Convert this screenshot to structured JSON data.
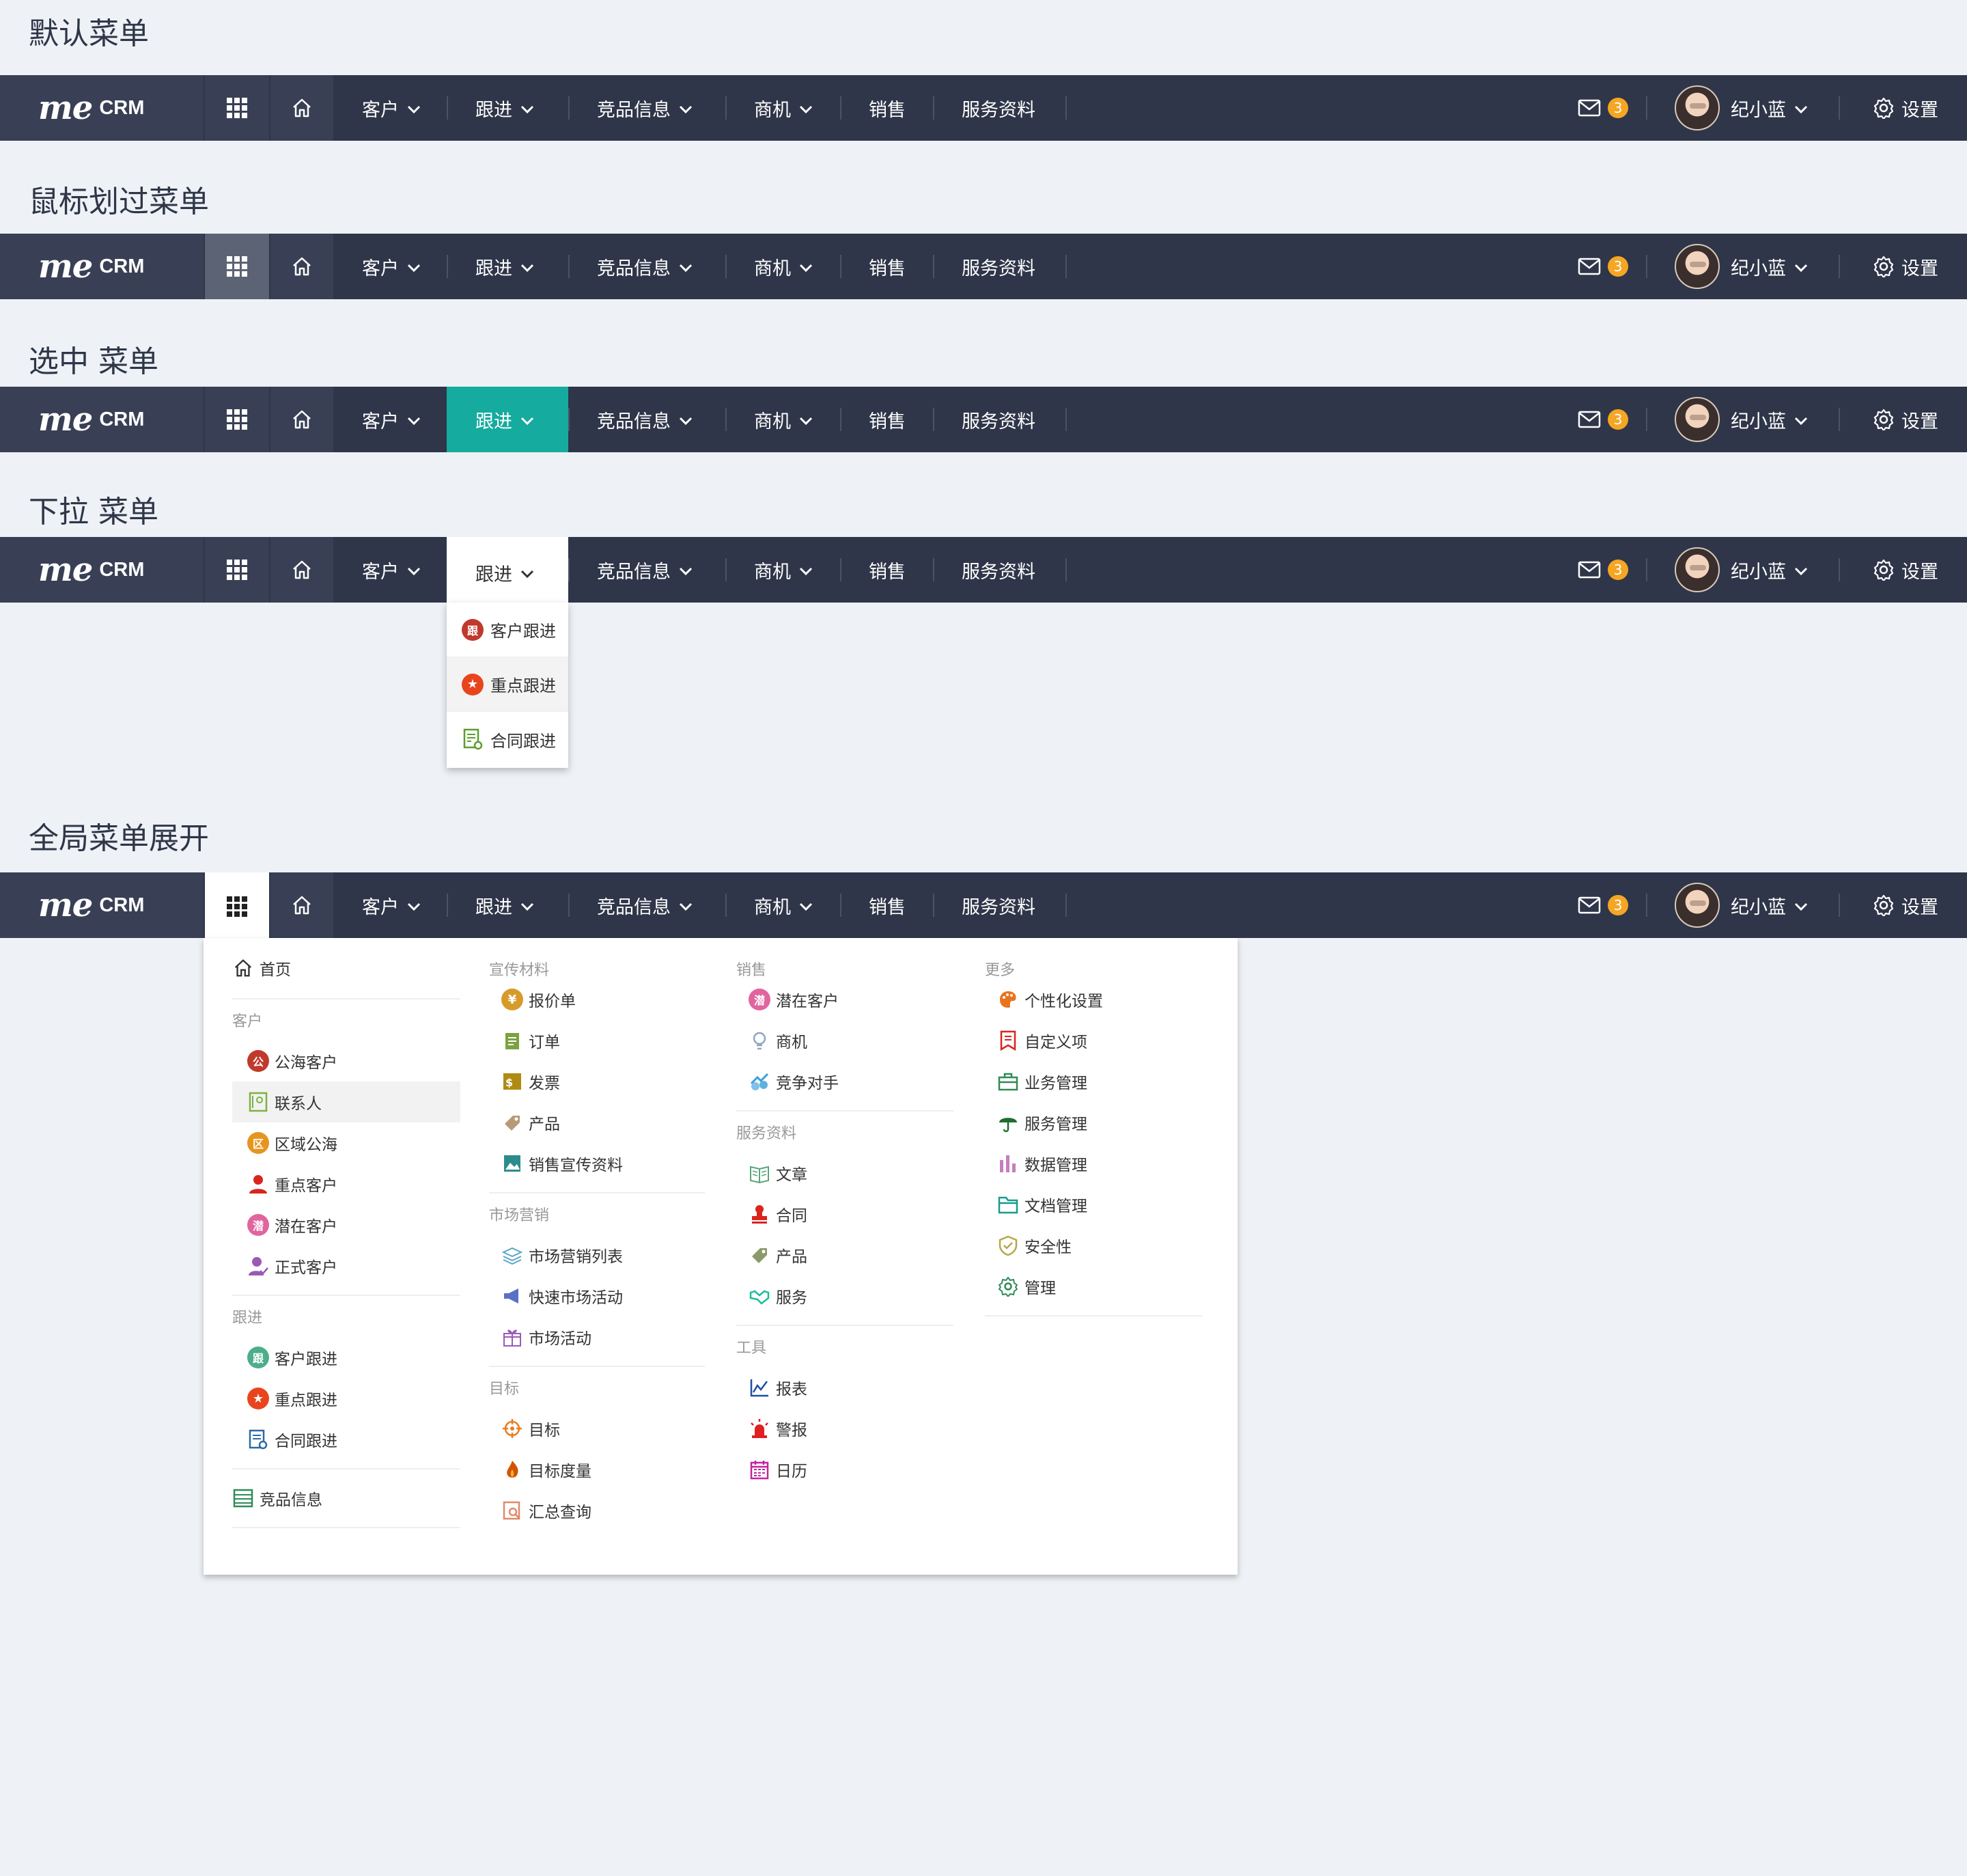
{
  "sections": {
    "default": "默认菜单",
    "hover": "鼠标划过菜单",
    "selected": "选中 菜单",
    "dropdown": "下拉 菜单",
    "global": "全局菜单展开"
  },
  "nav": {
    "logo_me": "me",
    "logo_crm": "CRM",
    "menus": [
      "客户",
      "跟进",
      "竞品信息",
      "商机",
      "销售",
      "服务资料"
    ],
    "mail_count": "3",
    "user_name": "纪小蓝",
    "settings": "设置"
  },
  "colors": {
    "navbar": "#2f3649",
    "logo_bg": "#394055",
    "selected": "#15ab9e",
    "hover": "#5c6374",
    "badge": "#f5a623",
    "page_bg": "#eef1f6"
  },
  "dropdown": {
    "items": [
      {
        "label": "客户跟进",
        "icon": "follow-circle-icon"
      },
      {
        "label": "重点跟进",
        "icon": "star-circle-icon"
      },
      {
        "label": "合同跟进",
        "icon": "contract-icon"
      }
    ]
  },
  "mega": {
    "col1": {
      "home": "首页",
      "customer_title": "客户",
      "customer_items": [
        "公海客户",
        "联系人",
        "区域公海",
        "重点客户",
        "潜在客户",
        "正式客户"
      ],
      "follow_title": "跟进",
      "follow_items": [
        "客户跟进",
        "重点跟进",
        "合同跟进"
      ],
      "competitor": "竞品信息"
    },
    "col2": {
      "promo_title": "宣传材料",
      "promo_items": [
        "报价单",
        "订单",
        "发票",
        "产品",
        "销售宣传资料"
      ],
      "marketing_title": "市场营销",
      "marketing_items": [
        "市场营销列表",
        "快速市场活动",
        "市场活动"
      ],
      "goal_title": "目标",
      "goal_items": [
        "目标",
        "目标度量",
        "汇总查询"
      ]
    },
    "col3": {
      "sales_title": "销售",
      "sales_items": [
        "潜在客户",
        "商机",
        "竞争对手"
      ],
      "service_title": "服务资料",
      "service_items": [
        "文章",
        "合同",
        "产品",
        "服务"
      ],
      "tools_title": "工具",
      "tools_items": [
        "报表",
        "警报",
        "日历"
      ]
    },
    "col4": {
      "more_title": "更多",
      "more_items": [
        "个性化设置",
        "自定义项",
        "业务管理",
        "服务管理",
        "数据管理",
        "文档管理",
        "安全性",
        "管理"
      ]
    }
  }
}
